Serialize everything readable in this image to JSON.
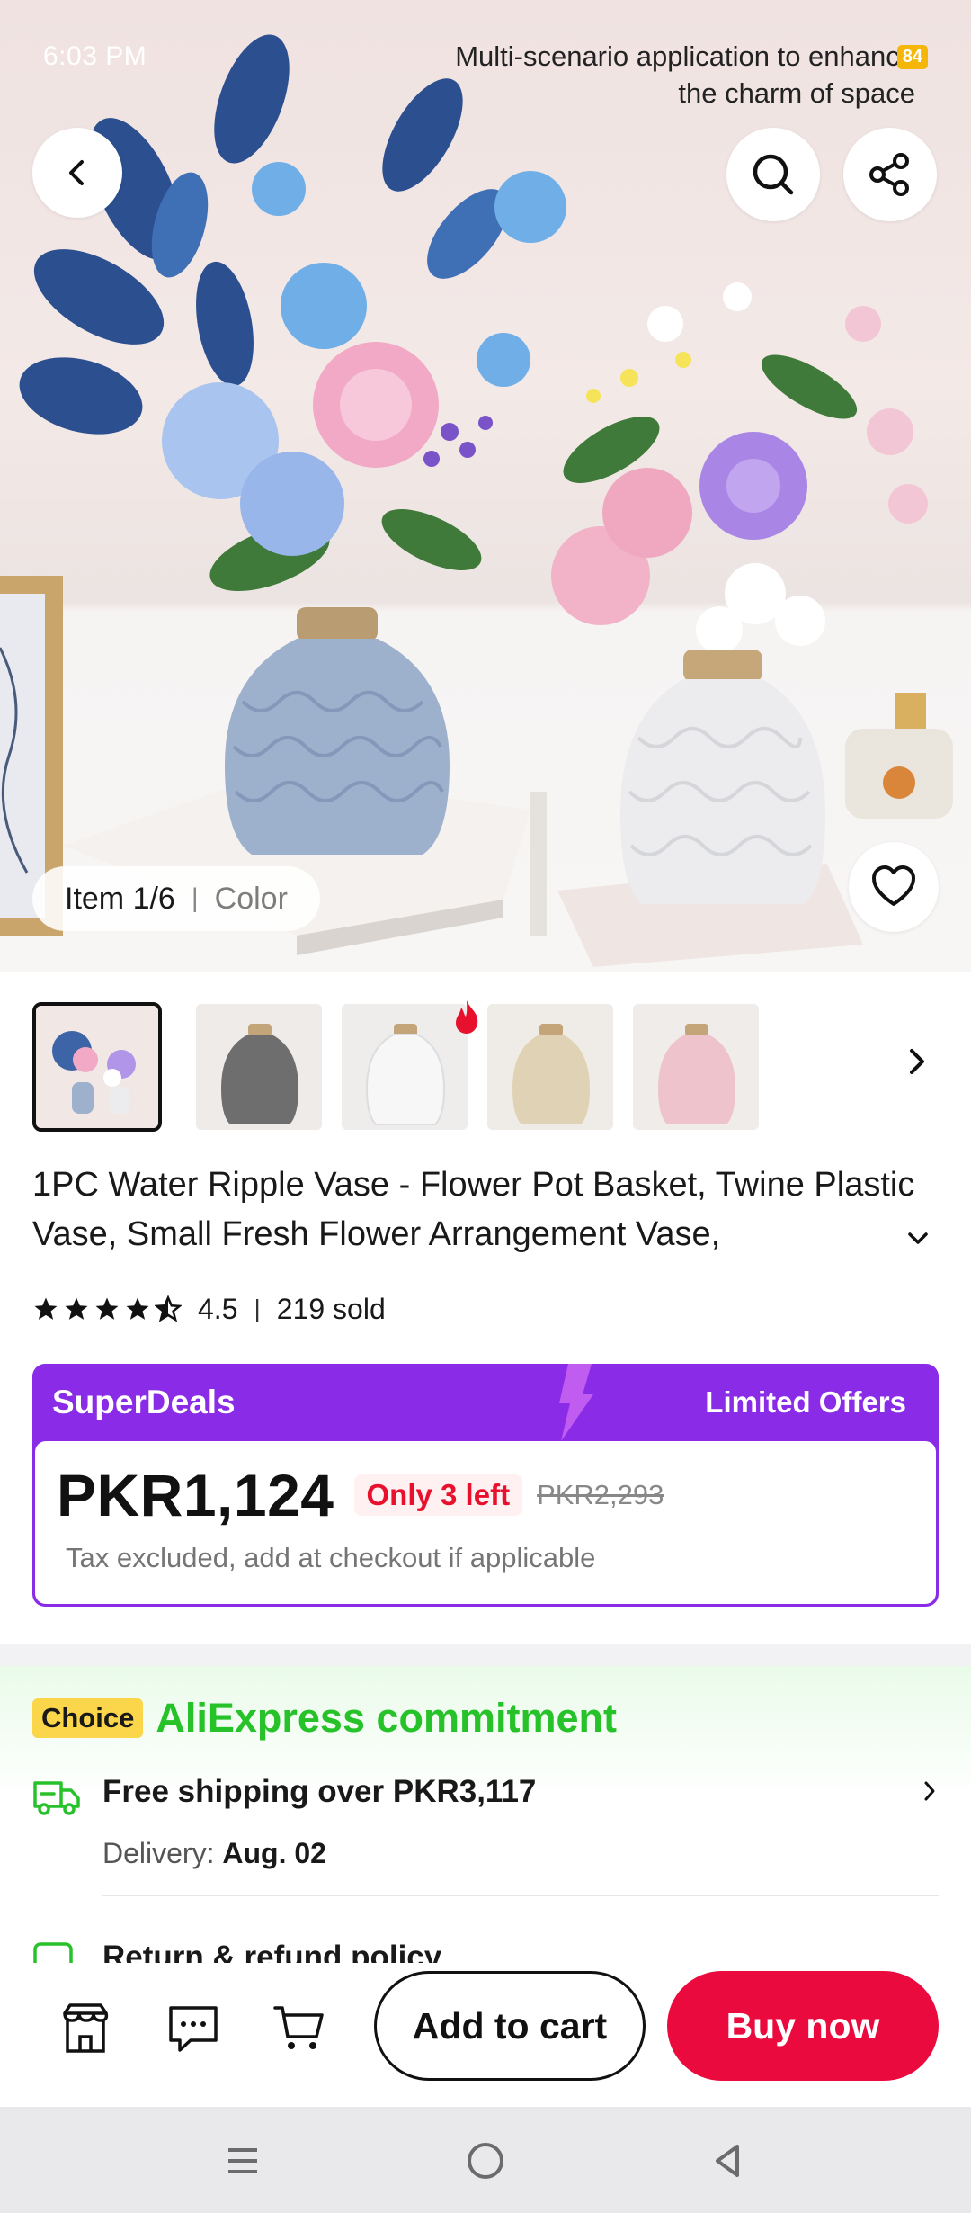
{
  "status_bar": {
    "time": "6:03 PM",
    "battery": "84"
  },
  "hero": {
    "caption_line1": "Multi-scenario application to enhance",
    "caption_line2": "the charm of space",
    "item_label": "Item 1/6",
    "variant_label": "Color"
  },
  "icons": {
    "back": "chevron-left-icon",
    "search": "search-icon",
    "share": "share-icon",
    "favorite": "heart-icon",
    "store": "store-icon",
    "chat": "chat-icon",
    "cart": "cart-icon"
  },
  "thumbnails": [
    {
      "name": "thumb-main-photo",
      "color": "#9bb7e3"
    },
    {
      "name": "thumb-gray-vase",
      "color": "#6e6e6e"
    },
    {
      "name": "thumb-white-vase",
      "color": "#e9e9ea"
    },
    {
      "name": "thumb-beige-vase",
      "color": "#e0d3b5"
    },
    {
      "name": "thumb-pink-vase",
      "color": "#efc3cb"
    }
  ],
  "product": {
    "title": "1PC Water Ripple Vase - Flower Pot Basket, Twine Plastic Vase, Small Fresh Flower Arrangement Vase,",
    "rating": "4.5",
    "sold": "219 sold"
  },
  "superdeals": {
    "label": "SuperDeals",
    "tag": "Limited Offers",
    "price": "PKR1,124",
    "stock_badge": "Only 3 left",
    "original_price": "PKR2,293",
    "tax_note": "Tax excluded, add at checkout if applicable",
    "accent": "#8a2be8"
  },
  "commitment": {
    "badge": "Choice",
    "title": "AliExpress commitment",
    "shipping_title": "Free shipping over PKR3,117",
    "delivery_label": "Delivery:",
    "delivery_date": "Aug. 02",
    "returns_title": "Return & refund policy",
    "accent": "#27c22a"
  },
  "actions": {
    "add_to_cart": "Add to cart",
    "buy_now": "Buy now",
    "buy_color": "#ea0a3e"
  }
}
